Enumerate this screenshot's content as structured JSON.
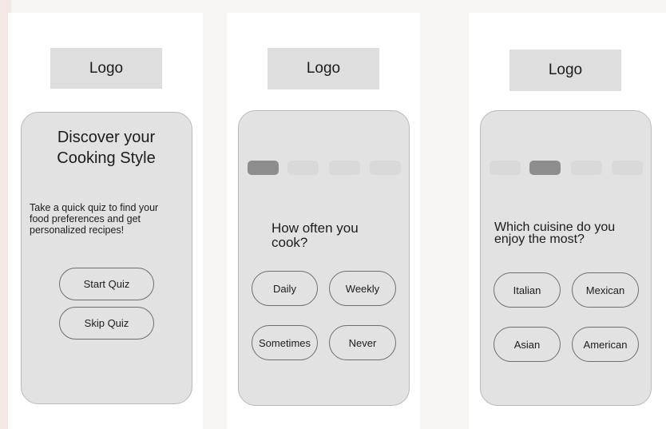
{
  "screens": [
    {
      "logo": "Logo",
      "title_line1": "Discover your",
      "title_line2": "Cooking Style",
      "description_line1": "Take a quick quiz to find your",
      "description_line2": "food preferences and get",
      "description_line3": "personalized recipes!",
      "buttons": [
        "Start Quiz",
        "Skip Quiz"
      ]
    },
    {
      "logo": "Logo",
      "progress_step": 1,
      "progress_total": 4,
      "question_line1": "How often you",
      "question_line2": "cook?",
      "options": [
        "Daily",
        "Weekly",
        "Sometimes",
        "Never"
      ]
    },
    {
      "logo": "Logo",
      "progress_step": 2,
      "progress_total": 4,
      "question_line1": "Which  cuisine do you",
      "question_line2": "enjoy the most?",
      "options": [
        "Italian",
        "Mexican",
        "Asian",
        "American"
      ]
    }
  ],
  "colors": {
    "screen_bg": "#ffffff",
    "card_bg": "#e2e2e2",
    "logo_bg": "#dedede",
    "progress_active": "#8d8d8d",
    "progress_inactive": "#d9d9d9"
  }
}
